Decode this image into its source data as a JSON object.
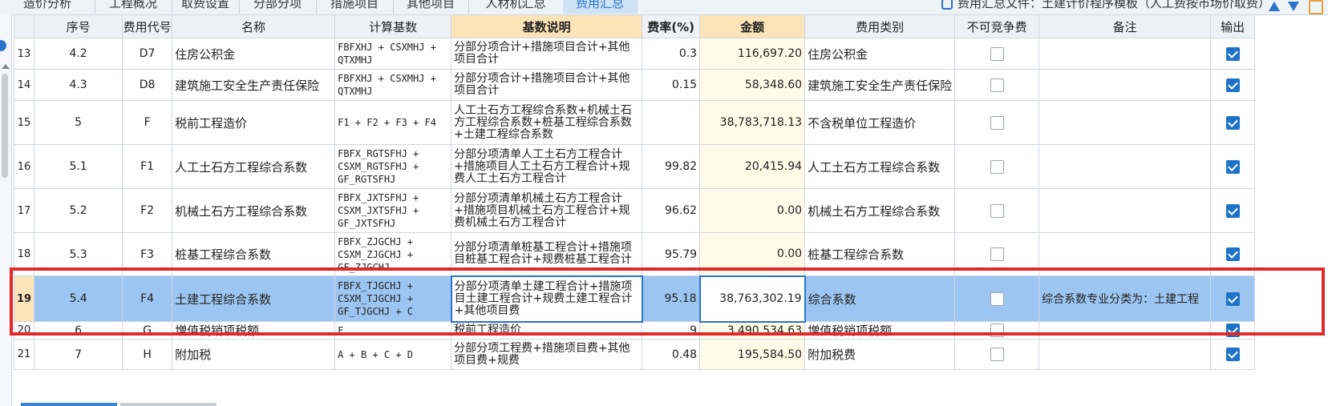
{
  "tabs": [
    {
      "label": "造价分析",
      "active": false
    },
    {
      "label": "工程概况",
      "active": false
    },
    {
      "label": "取费设置",
      "active": false
    },
    {
      "label": "分部分项",
      "active": false
    },
    {
      "label": "措施项目",
      "active": false
    },
    {
      "label": "其他项目",
      "active": false
    },
    {
      "label": "人材机汇总",
      "active": false
    },
    {
      "label": "费用汇总",
      "active": true
    }
  ],
  "file_info": "费用汇总文件：土建计价程序模板（人工费按市场价取费）",
  "icons": {
    "file": "file-icon",
    "up": "arrow-up-icon",
    "down": "arrow-down-icon",
    "tool": "tool-icon"
  },
  "colors": {
    "selected_row": "#9cc6f1",
    "highlight_header": "#fde3b8",
    "check_on": "#1e73c9",
    "frame": "#e02a2a"
  },
  "columns": {
    "seq": "序号",
    "code": "费用代号",
    "name": "名称",
    "base": "计算基数",
    "desc": "基数说明",
    "rate": "费率(%)",
    "amount": "金额",
    "category": "费用类别",
    "noncompete": "不可竞争费",
    "note": "备注",
    "output": "输出"
  },
  "rows": [
    {
      "idx": "13",
      "seq": "4.2",
      "code": "D7",
      "name": "住房公积金",
      "base": "FBFXHJ + CSXMHJ +\nQTXMHJ",
      "desc": "分部分项合计+措施项目合计+其他项目合计",
      "rate": "0.3",
      "amount": "116,697.20",
      "category": "住房公积金",
      "noncompete": false,
      "note": "",
      "output": true
    },
    {
      "idx": "14",
      "seq": "4.3",
      "code": "D8",
      "name": "建筑施工安全生产责任保险",
      "base": "FBFXHJ + CSXMHJ +\nQTXMHJ",
      "desc": "分部分项合计+措施项目合计+其他项目合计",
      "rate": "0.15",
      "amount": "58,348.60",
      "category": "建筑施工安全生产责任保险",
      "noncompete": false,
      "note": "",
      "output": true
    },
    {
      "idx": "15",
      "seq": "5",
      "code": "F",
      "name": "税前工程造价",
      "base": "F1 + F2 + F3 + F4",
      "desc": "人工土石方工程综合系数+机械土石方工程综合系数+桩基工程综合系数+土建工程综合系数",
      "rate": "",
      "amount": "38,783,718.13",
      "category": "不含税单位工程造价",
      "noncompete": false,
      "note": "",
      "output": true
    },
    {
      "idx": "16",
      "seq": "5.1",
      "code": "F1",
      "name": "人工土石方工程综合系数",
      "base": "FBFX_RGTSFHJ +\nCSXM_RGTSFHJ +\nGF_RGTSFHJ",
      "desc": "分部分项清单人工土石方工程合计+措施项目人工土石方工程合计+规费人工土石方工程合计",
      "rate": "99.82",
      "amount": "20,415.94",
      "category": "人工土石方工程综合系数",
      "noncompete": false,
      "note": "",
      "output": true
    },
    {
      "idx": "17",
      "seq": "5.2",
      "code": "F2",
      "name": "机械土石方工程综合系数",
      "base": "FBFX_JXTSFHJ +\nCSXM_JXTSFHJ +\nGF_JXTSFHJ",
      "desc": "分部分项清单机械土石方工程合计+措施项目机械土石方工程合计+规费机械土石方工程合计",
      "rate": "96.62",
      "amount": "0.00",
      "category": "机械土石方工程综合系数",
      "noncompete": false,
      "note": "",
      "output": true
    },
    {
      "idx": "18",
      "seq": "5.3",
      "code": "F3",
      "name": "桩基工程综合系数",
      "base": "FBFX_ZJGCHJ +\nCSXM_ZJGCHJ +\nGF_ZJGCHJ",
      "desc": "分部分项清单桩基工程合计+措施项目桩基工程合计+规费桩基工程合计",
      "rate": "95.79",
      "amount": "0.00",
      "category": "桩基工程综合系数",
      "noncompete": false,
      "note": "",
      "output": true
    },
    {
      "idx": "19",
      "seq": "5.4",
      "code": "F4",
      "name": "土建工程综合系数",
      "base": "FBFX_TJGCHJ +\nCSXM_TJGCHJ +\nGF_TJGCHJ + C",
      "desc": "分部分项清单土建工程合计+措施项目土建工程合计+规费土建工程合计+其他项目费",
      "rate": "95.18",
      "amount": "38,763,302.19",
      "category": "综合系数",
      "noncompete": false,
      "note": "综合系数专业分类为：土建工程",
      "output": true
    },
    {
      "idx": "20",
      "seq": "6",
      "code": "G",
      "name": "増值税销项税额",
      "base": "F",
      "desc": "税前工程造价",
      "rate": "9",
      "amount": "3,490,534.63",
      "category": "増值税销项税额",
      "noncompete": false,
      "note": "",
      "output": true
    },
    {
      "idx": "21",
      "seq": "7",
      "code": "H",
      "name": "附加税",
      "base": "A + B + C + D",
      "desc": "分部分项工程费+措施项目费+其他项目费+规费",
      "rate": "0.48",
      "amount": "195,584.50",
      "category": "附加税费",
      "noncompete": false,
      "note": "",
      "output": true
    }
  ]
}
